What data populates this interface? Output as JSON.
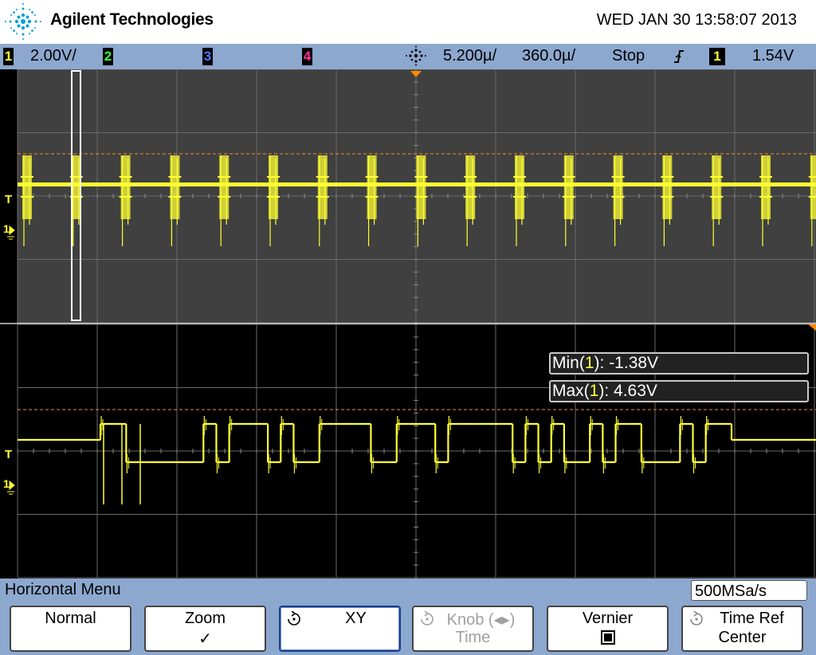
{
  "header": {
    "brand": "Agilent Technologies",
    "datetime": "WED JAN 30 13:58:07 2013",
    "logo_icon": "agilent-spark-icon"
  },
  "status_bar": {
    "ch1_num": "1",
    "ch1_scale": "2.00V/",
    "ch2_num": "2",
    "ch3_num": "3",
    "ch4_num": "4",
    "time_scale": "5.200µ/",
    "delay": "360.0µ/",
    "run_state": "Stop",
    "trigger_slope_icon": "rising-edge-icon",
    "trig_channel": "1",
    "trig_level": "1.54V",
    "colors": {
      "ch1": "#ffff33",
      "ch2": "#33ff33",
      "ch3": "#5577ff",
      "ch4": "#ff3399"
    }
  },
  "markers": {
    "trigger_label": "T",
    "ground_label": "1"
  },
  "measurements": {
    "min_prefix": "Min(",
    "min_ch": "1",
    "min_value": "): -1.38V",
    "max_prefix": "Max(",
    "max_ch": "1",
    "max_value": "): 4.63V"
  },
  "bottom_menu": {
    "title": "Horizontal Menu",
    "sample_rate": "500MSa/s",
    "softkeys": [
      {
        "label": "Normal",
        "sub": ""
      },
      {
        "label": "Zoom",
        "sub": "✓"
      },
      {
        "label": "XY",
        "sub": ""
      },
      {
        "label": "Knob (◂▸)",
        "sub": "Time"
      },
      {
        "label": "Vernier",
        "sub": "■"
      },
      {
        "label": "Time Ref",
        "sub": "Center"
      }
    ]
  },
  "waveform": {
    "channel": "1",
    "color": "#ffff33",
    "upper_burst_count": 17,
    "zoom_bits": "1100000010111010011110011101111101010010110001011"
  }
}
